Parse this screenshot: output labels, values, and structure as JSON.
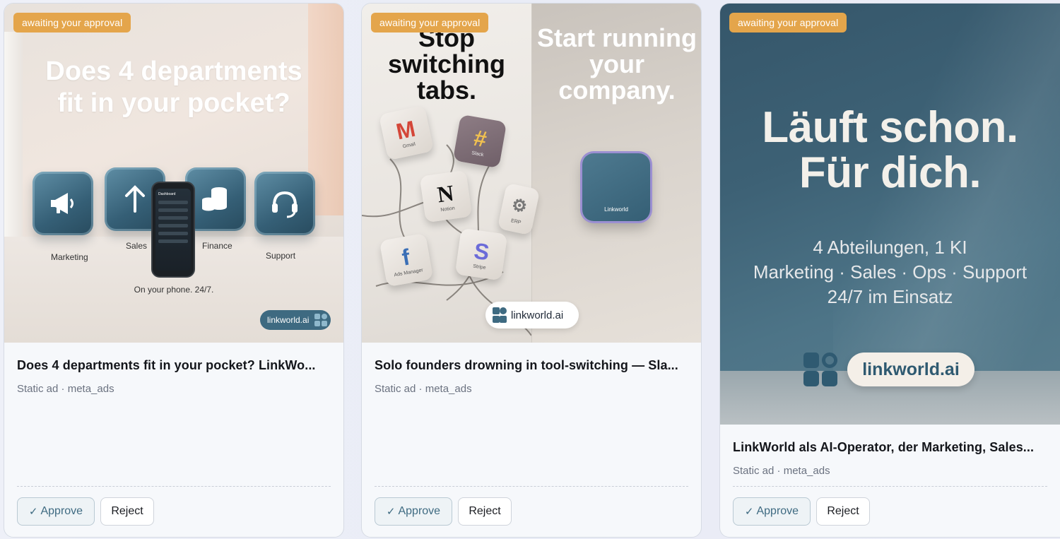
{
  "cards": [
    {
      "badge": "awaiting your approval",
      "creative": {
        "headline_line1": "Does 4 departments",
        "headline_line2": "fit in your pocket?",
        "tiles": [
          "Marketing",
          "Sales",
          "Finance",
          "Support"
        ],
        "phone_label": "Dashboard",
        "tagline": "On your phone. 24/7.",
        "logo_text": "linkworld.ai"
      },
      "title": "Does 4 departments fit in your pocket? LinkWo...",
      "subtitle": "Static ad · meta_ads",
      "approve_label": "Approve",
      "reject_label": "Reject"
    },
    {
      "badge": "awaiting your approval",
      "creative": {
        "headline_left": "Stop switching tabs.",
        "headline_right": "Start running your company.",
        "apps": [
          "Gmail",
          "Slack",
          "Notion",
          "ERP",
          "Ads Manager",
          "Stripe"
        ],
        "device_label": "Linkworld",
        "logo_text": "linkworld.ai"
      },
      "title": "Solo founders drowning in tool-switching — Sla...",
      "subtitle": "Static ad · meta_ads",
      "approve_label": "Approve",
      "reject_label": "Reject"
    },
    {
      "badge": "awaiting your approval",
      "creative": {
        "headline_line1": "Läuft schon.",
        "headline_line2": "Für dich.",
        "sub_line1": "4 Abteilungen, 1 KI",
        "sub_line2": "Marketing · Sales · Ops · Support",
        "sub_line3": "24/7 im Einsatz",
        "logo_text": "linkworld.ai"
      },
      "title": "LinkWorld als AI-Operator, der Marketing, Sales...",
      "subtitle": "Static ad · meta_ads",
      "approve_label": "Approve",
      "reject_label": "Reject"
    }
  ],
  "colors": {
    "badge": "#e4a54b",
    "approve_text": "#3f6b82",
    "brand_teal": "#3e6a81"
  }
}
